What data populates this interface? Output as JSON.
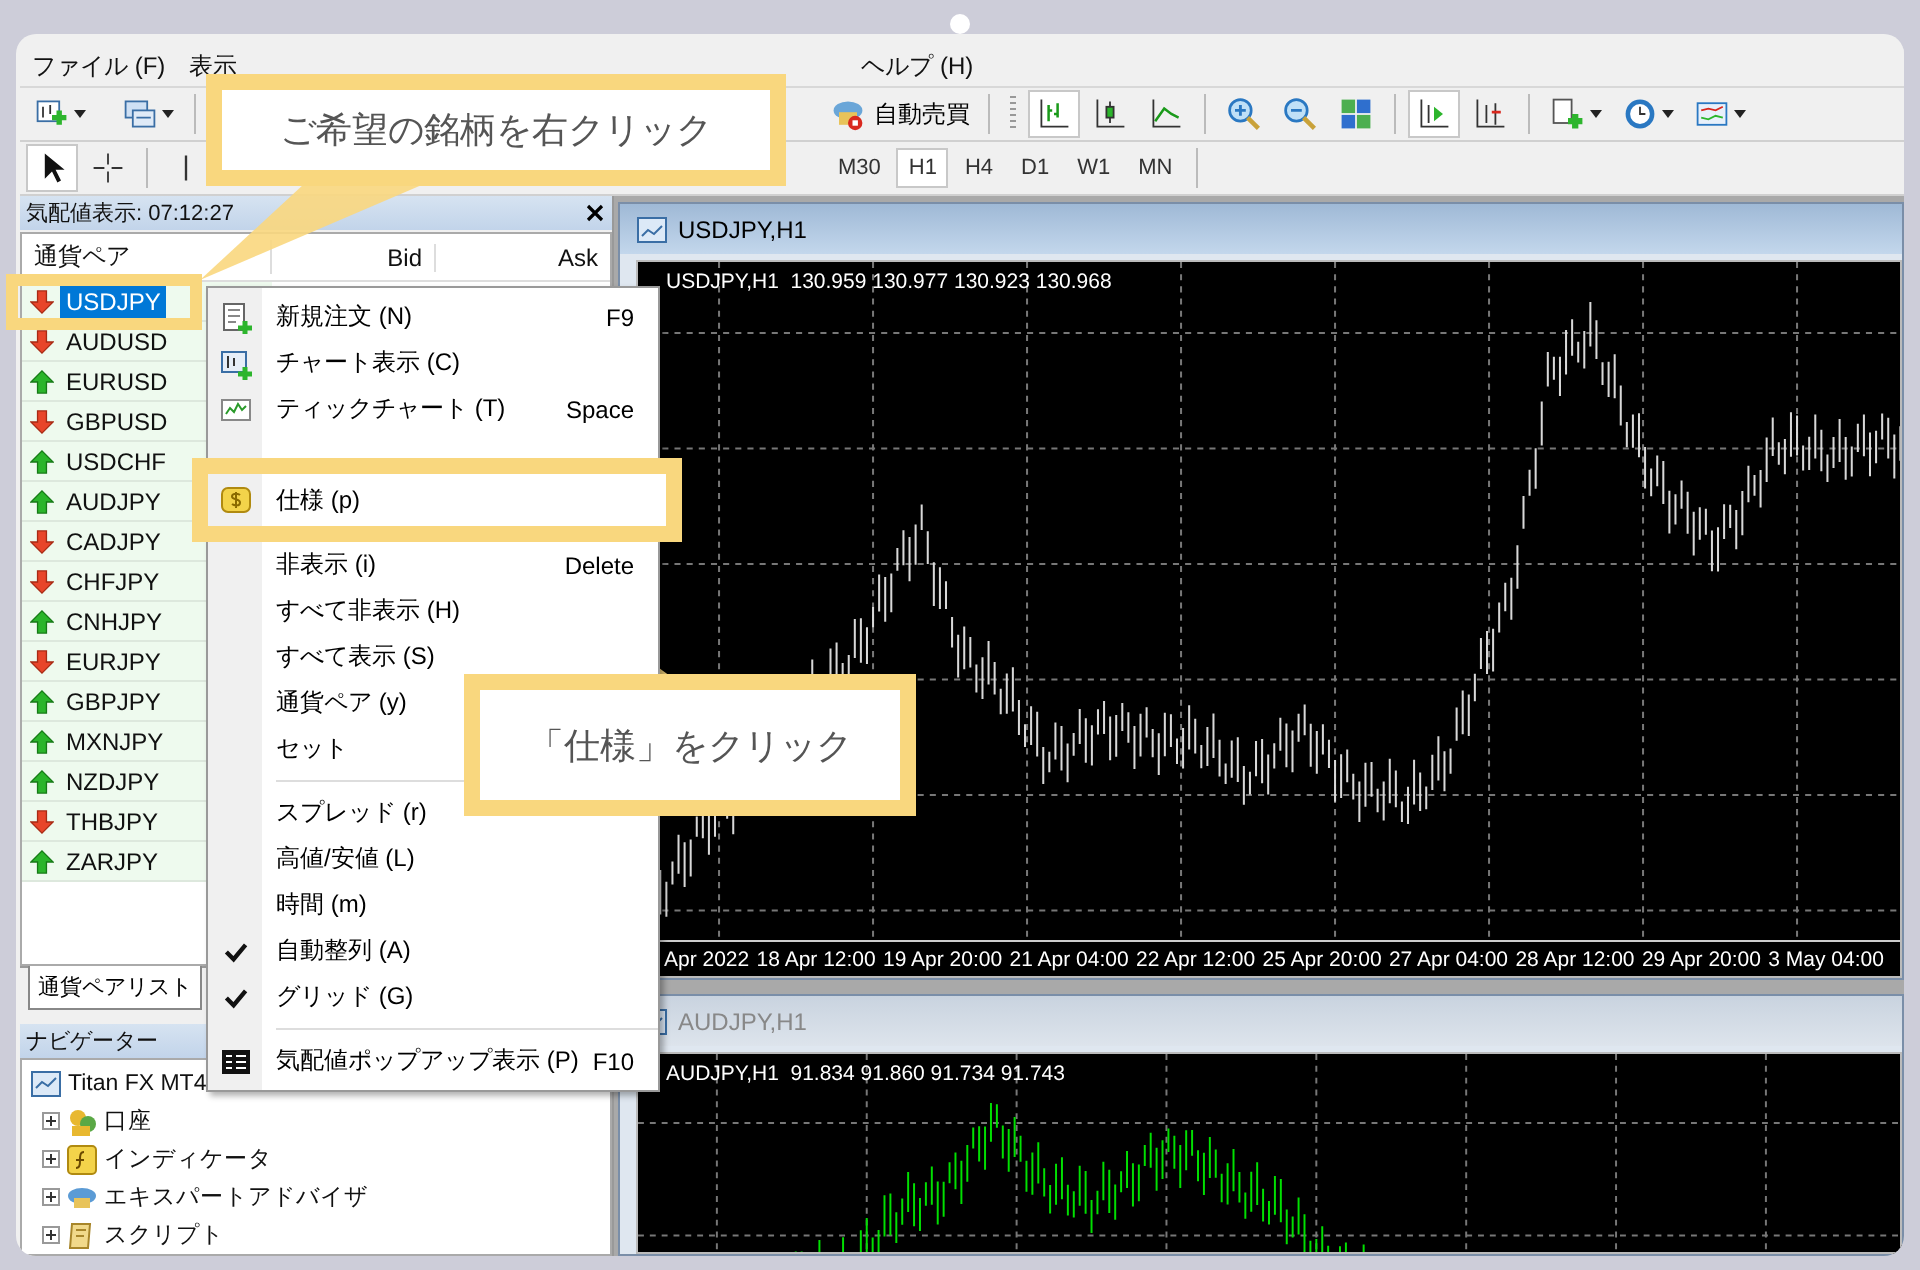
{
  "menu_bar": [
    {
      "label": "ファイル (F)"
    },
    {
      "label": "表示"
    },
    {
      "label": "ヘルプ (H)"
    }
  ],
  "toolbar": {
    "auto_trading": "自動売買"
  },
  "timeframes": [
    {
      "label": "M30",
      "selected": false
    },
    {
      "label": "H1",
      "selected": true
    },
    {
      "label": "H4",
      "selected": false
    },
    {
      "label": "D1",
      "selected": false
    },
    {
      "label": "W1",
      "selected": false
    },
    {
      "label": "MN",
      "selected": false
    }
  ],
  "market_watch": {
    "title": "気配値表示: 07:12:27",
    "columns": [
      "通貨ペア",
      "Bid",
      "Ask"
    ],
    "rows": [
      {
        "symbol": "USDJPY",
        "kind": "down",
        "selected": true
      },
      {
        "symbol": "AUDUSD",
        "kind": "down",
        "selected": false
      },
      {
        "symbol": "EURUSD",
        "kind": "up",
        "selected": false
      },
      {
        "symbol": "GBPUSD",
        "kind": "down",
        "selected": false
      },
      {
        "symbol": "USDCHF",
        "kind": "up",
        "selected": false
      },
      {
        "symbol": "AUDJPY",
        "kind": "up",
        "selected": false
      },
      {
        "symbol": "CADJPY",
        "kind": "down",
        "selected": false
      },
      {
        "symbol": "CHFJPY",
        "kind": "down",
        "selected": false
      },
      {
        "symbol": "CNHJPY",
        "kind": "up",
        "selected": false
      },
      {
        "symbol": "EURJPY",
        "kind": "down",
        "selected": false
      },
      {
        "symbol": "GBPJPY",
        "kind": "up",
        "selected": false
      },
      {
        "symbol": "MXNJPY",
        "kind": "up",
        "selected": false
      },
      {
        "symbol": "NZDJPY",
        "kind": "up",
        "selected": false
      },
      {
        "symbol": "THBJPY",
        "kind": "down",
        "selected": false
      },
      {
        "symbol": "ZARJPY",
        "kind": "up",
        "selected": false
      }
    ],
    "tabs": [
      {
        "label": "通貨ペアリスト",
        "selected": true
      }
    ]
  },
  "navigator": {
    "title": "ナビゲーター",
    "tree": [
      {
        "label": "Titan FX MT4",
        "children": [
          {
            "label": "口座",
            "kind": "accounts"
          },
          {
            "label": "インディケータ",
            "kind": "indicators"
          },
          {
            "label": "エキスパートアドバイザ",
            "kind": "experts"
          },
          {
            "label": "スクリプト",
            "kind": "scripts"
          }
        ]
      }
    ]
  },
  "charts": [
    {
      "title": "USDJPY,H1",
      "active": true,
      "info": "USDJPY,H1  130.959 130.977 130.923 130.968",
      "time_labels": [
        "Apr 2022",
        "18 Apr 12:00",
        "19 Apr 20:00",
        "21 Apr 04:00",
        "22 Apr 12:00",
        "25 Apr 20:00",
        "27 Apr 04:00",
        "28 Apr 12:00",
        "29 Apr 20:00",
        "3 May 04:00"
      ]
    },
    {
      "title": "AUDJPY,H1",
      "active": false,
      "info": "AUDJPY,H1  91.834 91.860 91.734 91.743"
    }
  ],
  "context_menu": {
    "items": [
      {
        "kind": "item",
        "label": "新規注文 (N)",
        "shortcut": "F9",
        "checked": false
      },
      {
        "kind": "item",
        "label": "チャート表示 (C)",
        "checked": false
      },
      {
        "kind": "item",
        "label": "ティックチャート (T)",
        "shortcut": "Space",
        "checked": false
      },
      {
        "kind": "highlighted",
        "label": "仕様 (p)",
        "checked": false
      },
      {
        "kind": "item",
        "label": "非表示 (i)",
        "shortcut": "Delete",
        "checked": false
      },
      {
        "kind": "item",
        "label": "すべて非表示 (H)",
        "checked": false
      },
      {
        "kind": "item",
        "label": "すべて表示 (S)",
        "checked": false
      },
      {
        "kind": "item",
        "label": "通貨ペア (y)",
        "checked": false
      },
      {
        "kind": "item",
        "label": "セット",
        "checked": false
      },
      {
        "kind": "separator"
      },
      {
        "kind": "item",
        "label": "スプレッド (r)",
        "checked": false
      },
      {
        "kind": "item",
        "label": "高値/安値 (L)",
        "checked": false
      },
      {
        "kind": "item",
        "label": "時間 (m)",
        "checked": false
      },
      {
        "kind": "item",
        "label": "自動整列 (A)",
        "checked": true
      },
      {
        "kind": "item",
        "label": "グリッド (G)",
        "checked": true
      },
      {
        "kind": "separator"
      },
      {
        "kind": "item",
        "label": "気配値ポップアップ表示 (P)",
        "shortcut": "F10",
        "checked": false
      }
    ]
  },
  "callouts": [
    {
      "text": "ご希望の銘柄を右クリック"
    },
    {
      "text": "「仕様」をクリック"
    }
  ]
}
